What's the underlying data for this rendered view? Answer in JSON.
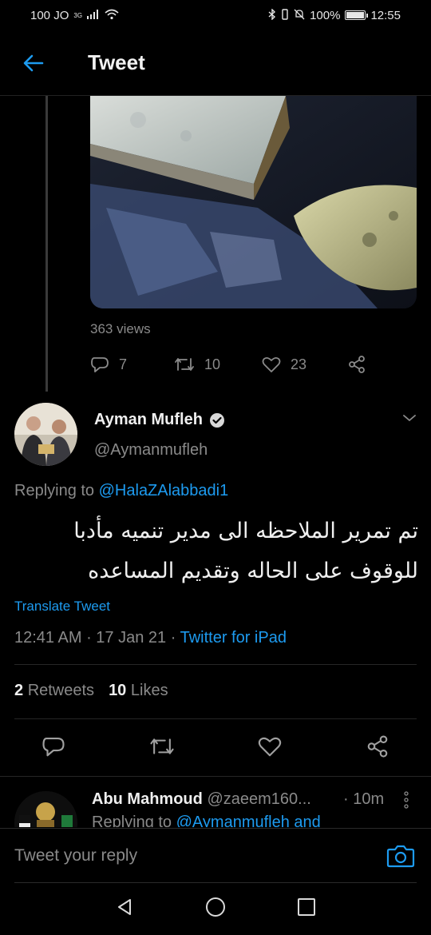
{
  "status_bar": {
    "carrier": "100 JO",
    "network": "3G",
    "battery": "100%",
    "battery_level": 1.0,
    "time": "12:55"
  },
  "header": {
    "title": "Tweet"
  },
  "parent_tweet": {
    "views": "363 views",
    "replies": "7",
    "retweets": "10",
    "likes": "23"
  },
  "main_tweet": {
    "author_name": "Ayman Mufleh",
    "author_handle": "@Aymanmufleh",
    "replying_prefix": "Replying to",
    "replying_to": "@HalaZAlabbadi1",
    "text_line1": "تم تمرير الملاحظه الى مدير تنميه مأدبا",
    "text_line2": "للوقوف على الحاله وتقديم المساعده",
    "translate_label": "Translate Tweet",
    "time": "12:41 AM",
    "date": "17 Jan 21",
    "source": "Twitter for iPad",
    "retweet_count": "2",
    "retweet_label": "Retweets",
    "like_count": "10",
    "like_label": "Likes"
  },
  "reply": {
    "author_name": "Abu Mahmoud",
    "author_handle": "@zaeem160...",
    "time": "· 10m",
    "replying_prefix": "Replying to",
    "replying_to": "@Aymanmufleh and"
  },
  "compose": {
    "placeholder": "Tweet your reply"
  },
  "colors": {
    "accent": "#1d9bf0",
    "background": "#000000",
    "muted": "#8a8a8a"
  },
  "icons": {
    "back": "arrow-left-icon",
    "verified": "verified-badge-icon",
    "reply": "reply-icon",
    "retweet": "retweet-icon",
    "like": "heart-icon",
    "share": "share-icon",
    "camera": "camera-icon"
  }
}
